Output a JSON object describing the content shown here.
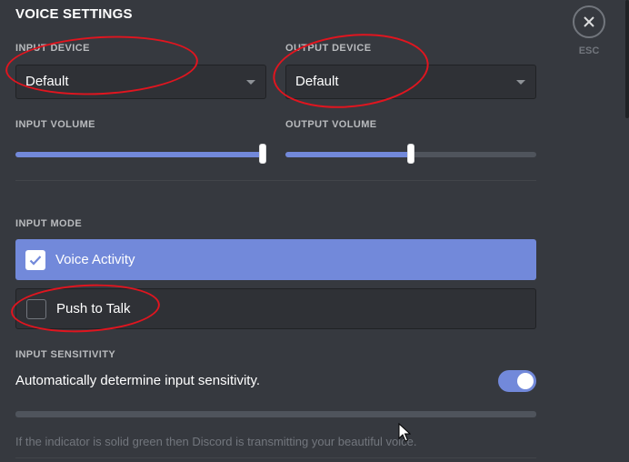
{
  "section_title": "VOICE SETTINGS",
  "input_device": {
    "label": "INPUT DEVICE",
    "value": "Default"
  },
  "output_device": {
    "label": "OUTPUT DEVICE",
    "value": "Default"
  },
  "input_volume": {
    "label": "INPUT VOLUME",
    "level_percent": 100
  },
  "output_volume": {
    "label": "OUTPUT VOLUME",
    "level_percent": 50
  },
  "input_mode": {
    "label": "INPUT MODE",
    "options": [
      {
        "label": "Voice Activity",
        "selected": true
      },
      {
        "label": "Push to Talk",
        "selected": false
      }
    ]
  },
  "input_sensitivity": {
    "label": "INPUT SENSITIVITY",
    "auto_text": "Automatically determine input sensitivity.",
    "auto_enabled": true,
    "hint": "If the indicator is solid green then Discord is transmitting your beautiful voice."
  },
  "close": {
    "esc_label": "ESC"
  },
  "colors": {
    "accent": "#7289da",
    "annotation": "#e0151f",
    "background": "#36393f"
  },
  "icons": {
    "close": "close-icon",
    "check": "check-icon",
    "caret": "chevron-down-icon",
    "cursor": "mouse-cursor-icon"
  }
}
